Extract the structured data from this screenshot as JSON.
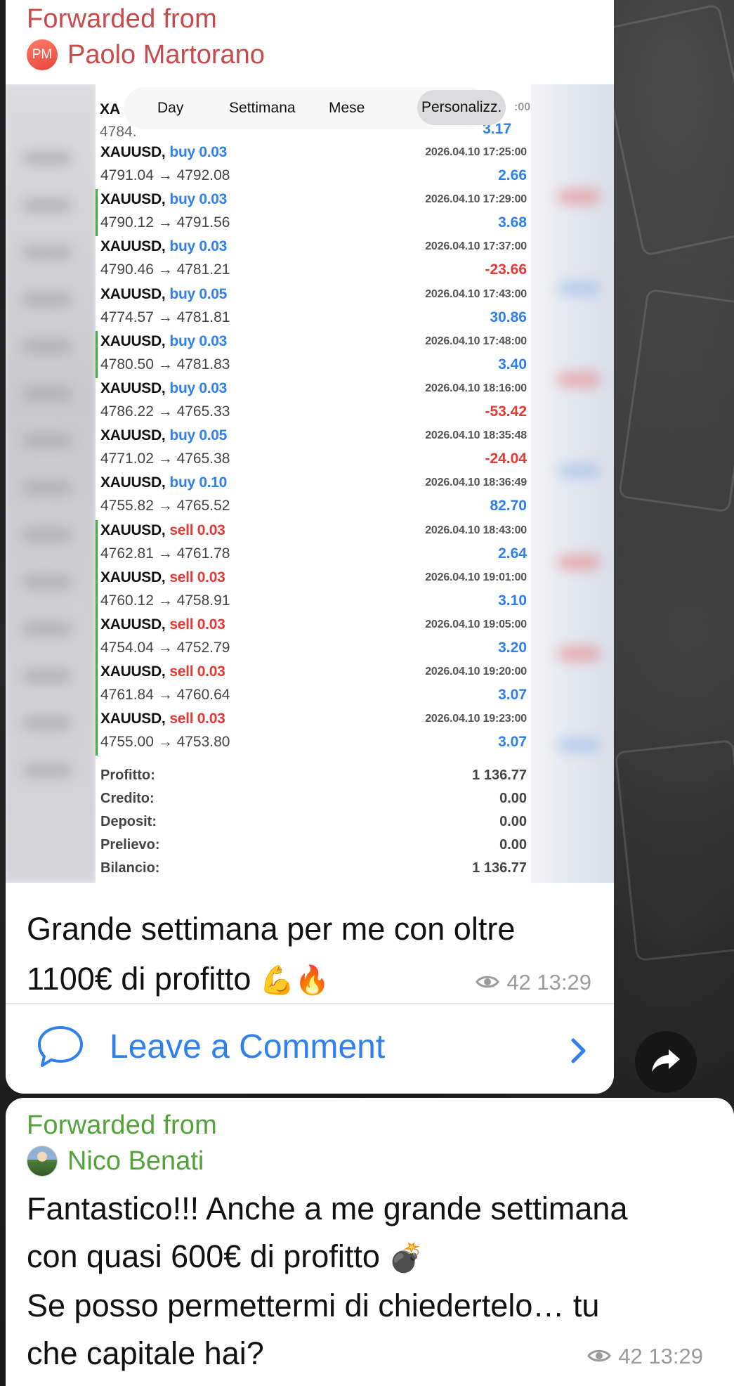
{
  "message1": {
    "forwarded_label": "Forwarded from",
    "sender_initials": "PM",
    "sender_name": "Paolo Martorano",
    "photo": {
      "tabs": [
        "Day",
        "Settimana",
        "Mese",
        "Personalizz."
      ],
      "tab_time_fragment": ":00",
      "partial_top_symbol": "XA",
      "partial_top_prices": "4784.",
      "partial_top_profit": "3.17",
      "trades": [
        {
          "symbol": "XAUUSD,",
          "side": "buy",
          "volume": "buy 0.03",
          "prices": "4791.04 → 4792.08",
          "time": "2026.04.10 17:25:00",
          "profit": "2.66",
          "marker": false
        },
        {
          "symbol": "XAUUSD,",
          "side": "buy",
          "volume": "buy 0.03",
          "prices": "4790.12 → 4791.56",
          "time": "2026.04.10 17:29:00",
          "profit": "3.68",
          "marker": true
        },
        {
          "symbol": "XAUUSD,",
          "side": "buy",
          "volume": "buy 0.03",
          "prices": "4790.46 → 4781.21",
          "time": "2026.04.10 17:37:00",
          "profit": "-23.66",
          "marker": false
        },
        {
          "symbol": "XAUUSD,",
          "side": "buy",
          "volume": "buy 0.05",
          "prices": "4774.57 → 4781.81",
          "time": "2026.04.10 17:43:00",
          "profit": "30.86",
          "marker": false
        },
        {
          "symbol": "XAUUSD,",
          "side": "buy",
          "volume": "buy 0.03",
          "prices": "4780.50 → 4781.83",
          "time": "2026.04.10 17:48:00",
          "profit": "3.40",
          "marker": true
        },
        {
          "symbol": "XAUUSD,",
          "side": "buy",
          "volume": "buy 0.03",
          "prices": "4786.22 → 4765.33",
          "time": "2026.04.10 18:16:00",
          "profit": "-53.42",
          "marker": false
        },
        {
          "symbol": "XAUUSD,",
          "side": "buy",
          "volume": "buy 0.05",
          "prices": "4771.02 → 4765.38",
          "time": "2026.04.10 18:35:48",
          "profit": "-24.04",
          "marker": false
        },
        {
          "symbol": "XAUUSD,",
          "side": "buy",
          "volume": "buy 0.10",
          "prices": "4755.82 → 4765.52",
          "time": "2026.04.10 18:36:49",
          "profit": "82.70",
          "marker": false
        },
        {
          "symbol": "XAUUSD,",
          "side": "sell",
          "volume": "sell 0.03",
          "prices": "4762.81 → 4761.78",
          "time": "2026.04.10 18:43:00",
          "profit": "2.64",
          "marker": true
        },
        {
          "symbol": "XAUUSD,",
          "side": "sell",
          "volume": "sell 0.03",
          "prices": "4760.12 → 4758.91",
          "time": "2026.04.10 19:01:00",
          "profit": "3.10",
          "marker": true
        },
        {
          "symbol": "XAUUSD,",
          "side": "sell",
          "volume": "sell 0.03",
          "prices": "4754.04 → 4752.79",
          "time": "2026.04.10 19:05:00",
          "profit": "3.20",
          "marker": true
        },
        {
          "symbol": "XAUUSD,",
          "side": "sell",
          "volume": "sell 0.03",
          "prices": "4761.84 → 4760.64",
          "time": "2026.04.10 19:20:00",
          "profit": "3.07",
          "marker": true
        },
        {
          "symbol": "XAUUSD,",
          "side": "sell",
          "volume": "sell 0.03",
          "prices": "4755.00 → 4753.80",
          "time": "2026.04.10 19:23:00",
          "profit": "3.07",
          "marker": true
        }
      ],
      "summary": [
        {
          "label": "Profitto:",
          "value": "1 136.77"
        },
        {
          "label": "Credito:",
          "value": "0.00"
        },
        {
          "label": "Deposit:",
          "value": "0.00"
        },
        {
          "label": "Prelievo:",
          "value": "0.00"
        },
        {
          "label": "Bilancio:",
          "value": "1 136.77"
        }
      ]
    },
    "caption_line1": "Grande settimana per me con oltre",
    "caption_line2": "1100€ di profitto",
    "caption_emoji_1": "💪",
    "caption_emoji_2": "🔥",
    "views": "42",
    "time": "13:29",
    "comment_label": "Leave a Comment"
  },
  "message2": {
    "forwarded_label": "Forwarded from",
    "sender_name": "Nico Benati",
    "text_line1": "Fantastico!!! Anche a me grande settimana",
    "text_line2": "con quasi 600€ di profitto",
    "text_emoji": "💣",
    "text_line3": "Se posso permettermi di chiedertelo… tu",
    "text_line4": "che capitale hai?",
    "views": "42",
    "time": "13:29"
  },
  "colors": {
    "link_blue": "#2f80ed",
    "loss_red": "#e53935",
    "forward_red": "#c94a4a",
    "forward_green": "#53a33a",
    "marker_green": "#3cb043"
  }
}
